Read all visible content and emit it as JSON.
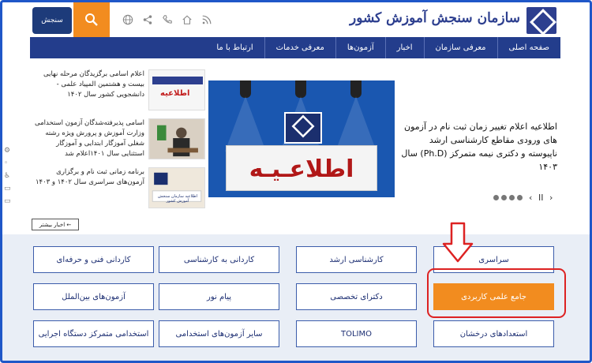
{
  "header": {
    "logo_text": "سازمان سنجش آموزش کشور",
    "logo_left_text": "سنجش",
    "icons": [
      "globe-icon",
      "share-icon",
      "phone-icon",
      "home-icon",
      "rss-icon"
    ]
  },
  "nav": {
    "items": [
      "صفحه اصلی",
      "معرفی سازمان",
      "اخبار",
      "آزمون‌ها",
      "معرفی خدمات",
      "ارتباط با ما"
    ]
  },
  "news": [
    {
      "text": "اعلام اسامی برگزیدگان مرحله نهایی بیست و هشتمین المپیاد علمی - دانشجویی کشور سال ۱۴۰۲",
      "thumb_label": "اطلاعیه"
    },
    {
      "text": "اسامی پذیرفته‌شدگان آزمون استخدامی وزارت آموزش و پرورش ویژه رشته شغلی آموزگار ابتدایی و آموزگار استثنایی سال ۱۴۰۱اعلام شد"
    },
    {
      "text": "برنامه زمانی ثبت نام و برگزاری آزمون‌های سراسری سال ۱۴۰۲ و ۱۴۰۳",
      "thumb_label": "اطلاعیه سازمان سنجش آموزش کشور"
    }
  ],
  "slider": {
    "sign_text": "اطلاعـیـه",
    "caption": "اطلاعیه اعلام تغییر زمان ثبت نام در آزمون های ورودی مقاطع کارشناسی ارشد ناپیوسته و دکتری نیمه متمرکز (Ph.D) سال ۱۴۰۳",
    "pause": "II",
    "prev": "‹",
    "next": "›"
  },
  "more_button": "اخبار بیشتر ←",
  "tiles": [
    {
      "label": "سراسری",
      "active": false
    },
    {
      "label": "کارشناسی ارشد",
      "active": false
    },
    {
      "label": "کاردانی به کارشناسی",
      "active": false
    },
    {
      "label": "کاردانی فنی و حرفه‌ای",
      "active": false
    },
    {
      "label": "جامع علمی کاربردی",
      "active": true
    },
    {
      "label": "دکترای تخصصی",
      "active": false
    },
    {
      "label": "پیام نور",
      "active": false
    },
    {
      "label": "آزمون‌های بین‌الملل",
      "active": false
    },
    {
      "label": "استعدادهای درخشان",
      "active": false
    },
    {
      "label": "TOLIMO",
      "active": false
    },
    {
      "label": "سایر آزمون‌های استخدامی",
      "active": false
    },
    {
      "label": "استخدامی متمرکز دستگاه اجرایی",
      "active": false
    }
  ],
  "colors": {
    "accent": "#f28c1f",
    "navy": "#233d8c",
    "highlight": "#dd2222"
  }
}
